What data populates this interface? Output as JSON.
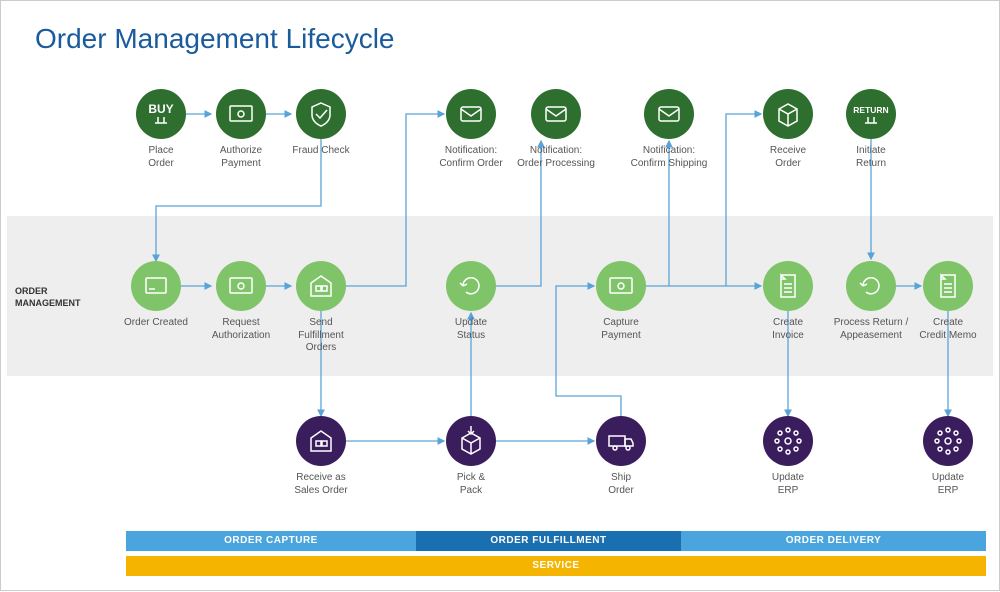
{
  "title": "Order Management Lifecycle",
  "band_label": "ORDER\nMANAGEMENT",
  "nodes": {
    "place_order": "Place\nOrder",
    "authorize_payment": "Authorize\nPayment",
    "fraud_check": "Fraud Check",
    "notif_confirm_order": "Notification:\nConfirm Order",
    "notif_processing": "Notification:\nOrder Processing",
    "notif_shipping": "Notification:\nConfirm Shipping",
    "receive_order": "Receive\nOrder",
    "initiate_return": "Initiate\nReturn",
    "order_created": "Order Created",
    "request_auth": "Request\nAuthorization",
    "send_fulfillment": "Send\nFulfillment\nOrders",
    "update_status": "Update\nStatus",
    "capture_payment": "Capture\nPayment",
    "create_invoice": "Create\nInvoice",
    "process_return": "Process Return /\nAppeasement",
    "create_credit_memo": "Create\nCredit Memo",
    "receive_sales_order": "Receive as\nSales Order",
    "pick_pack": "Pick &\nPack",
    "ship_order": "Ship\nOrder",
    "update_erp_1": "Update\nERP",
    "update_erp_2": "Update\nERP"
  },
  "phase_bars": {
    "capture": "ORDER CAPTURE",
    "fulfill": "ORDER FULFILLMENT",
    "deliver": "ORDER DELIVERY",
    "service": "SERVICE"
  },
  "buy_text": "BUY",
  "return_text": "RETURN"
}
